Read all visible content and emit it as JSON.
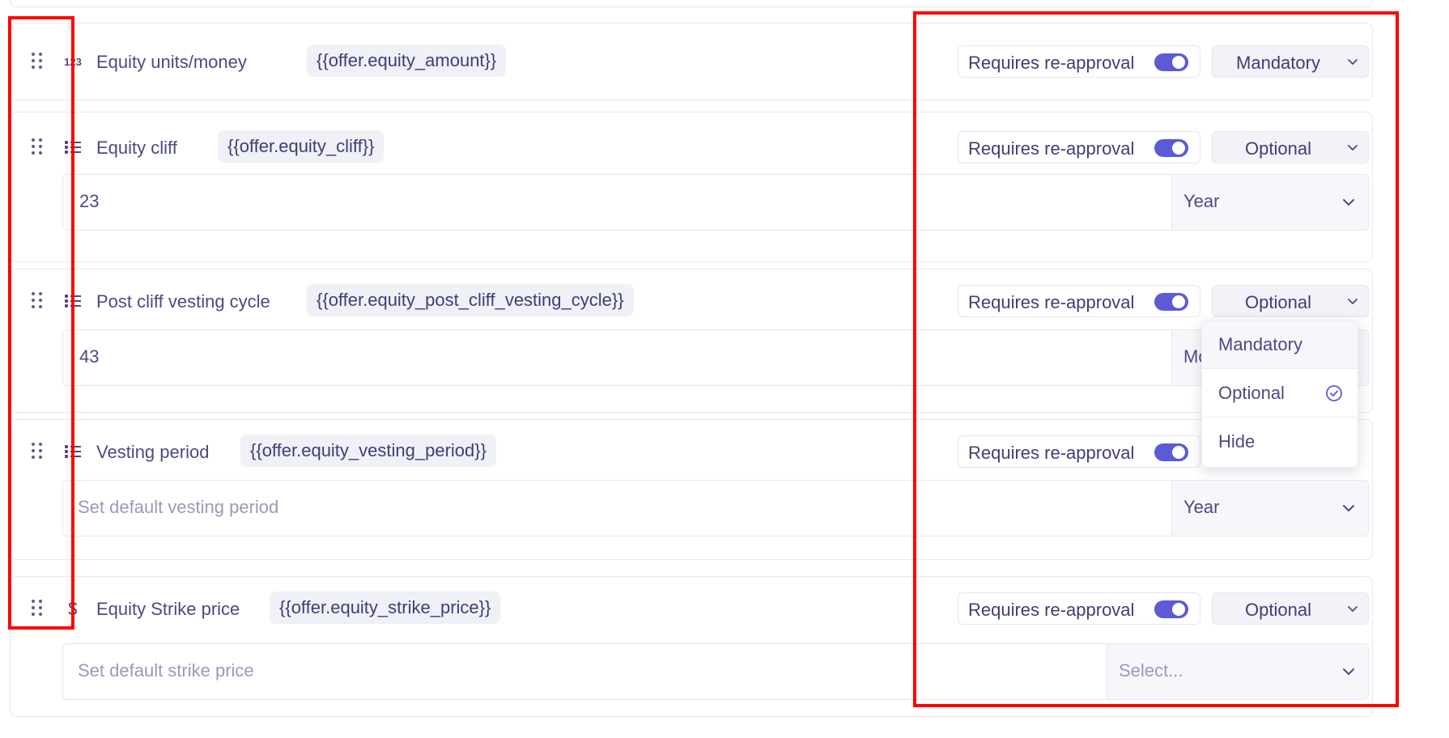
{
  "toggle_label": "Requires re-approval",
  "fields": [
    {
      "label": "Equity units/money",
      "variable": "{{offer.equity_amount}}",
      "requirement": "Mandatory",
      "icon": "number-123-icon"
    },
    {
      "label": "Equity cliff",
      "variable": "{{offer.equity_cliff}}",
      "requirement": "Optional",
      "icon": "list-icon",
      "value": "23",
      "unit": "Year"
    },
    {
      "label": "Post cliff vesting cycle",
      "variable": "{{offer.equity_post_cliff_vesting_cycle}}",
      "requirement": "Optional",
      "icon": "list-icon",
      "value": "43",
      "unit": "Mo"
    },
    {
      "label": "Vesting period",
      "variable": "{{offer.equity_vesting_period}}",
      "requirement": "",
      "icon": "list-icon",
      "placeholder": "Set default vesting period",
      "unit": "Year"
    },
    {
      "label": "Equity Strike price",
      "variable": "{{offer.equity_strike_price}}",
      "requirement": "Optional",
      "icon": "dollar-icon",
      "placeholder": "Set default strike price",
      "unit_placeholder": "Select..."
    }
  ],
  "dropdown_menu": {
    "options": [
      "Mandatory",
      "Optional",
      "Hide"
    ],
    "selected": "Optional"
  },
  "number_icon_text": "123",
  "accent_color": "#5b5bd6",
  "annotation_color": "#ff0000"
}
